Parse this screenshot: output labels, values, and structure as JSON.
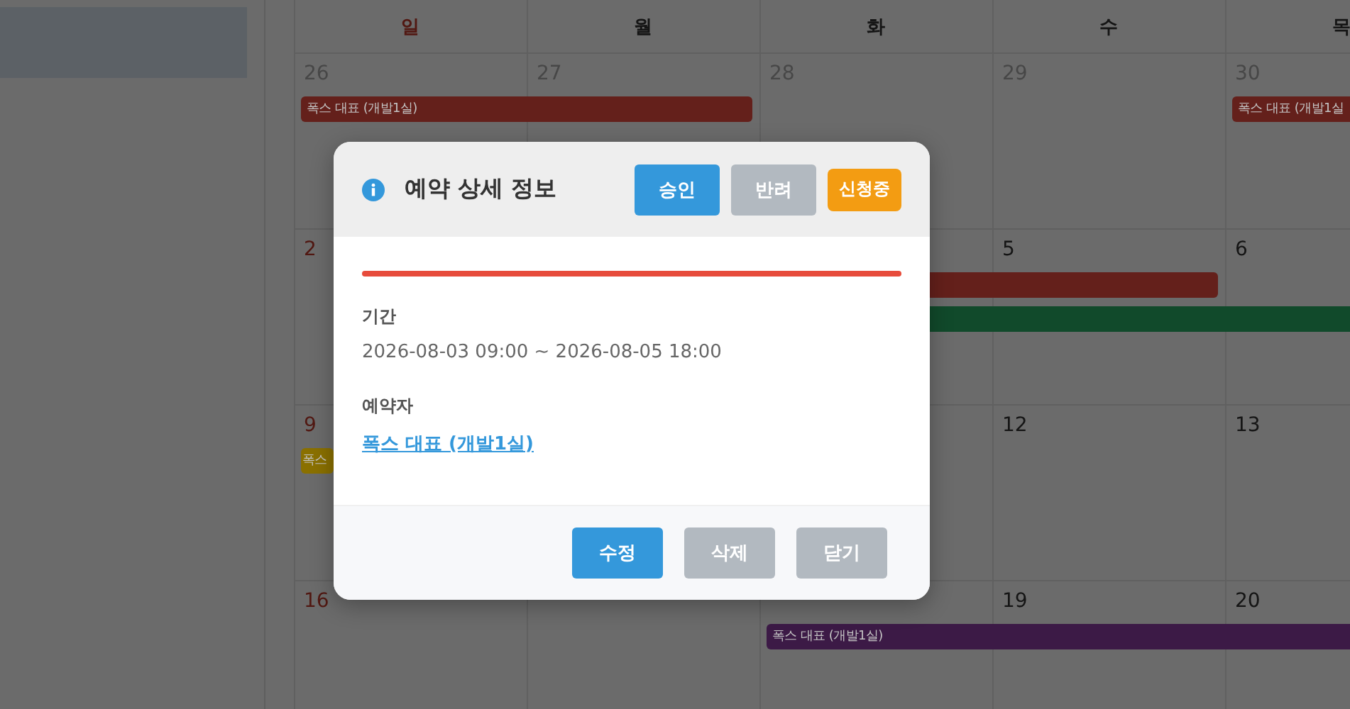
{
  "calendar": {
    "weekdays": [
      {
        "label": "일",
        "kind": "sunday"
      },
      {
        "label": "월",
        "kind": "weekday"
      },
      {
        "label": "화",
        "kind": "weekday"
      },
      {
        "label": "수",
        "kind": "weekday"
      },
      {
        "label": "목",
        "kind": "weekday"
      }
    ],
    "weeks": [
      {
        "days": [
          {
            "kind": "date",
            "label": "26",
            "muted": true,
            "events": [
              {
                "label": "폭스 대표 (개발1실)",
                "color": "#64201b",
                "kind": "two-days"
              }
            ]
          },
          {
            "kind": "date",
            "label": "27",
            "muted": true
          },
          {
            "kind": "date",
            "label": "28",
            "muted": true
          },
          {
            "kind": "date",
            "label": "29",
            "muted": true
          },
          {
            "kind": "date",
            "label": "30",
            "muted": true,
            "events": [
              {
                "label": "폭스 대표 (개발1실",
                "color": "#64201b",
                "kind": "to-edge"
              }
            ]
          }
        ]
      },
      {
        "days": [
          {
            "kind": "date",
            "label": "2",
            "muted": false
          },
          {
            "kind": "covered",
            "events": [
              {
                "color": "#64201b",
                "kind": "three-days"
              },
              {
                "color": "#114a2b",
                "kind": "to-edge"
              }
            ]
          },
          {
            "kind": "covered"
          },
          {
            "kind": "date",
            "label": "5",
            "muted": false
          },
          {
            "kind": "date",
            "label": "6",
            "muted": false
          }
        ]
      },
      {
        "days": [
          {
            "kind": "date",
            "label": "9",
            "muted": false,
            "events": [
              {
                "label": "폭스",
                "color": "#8a7000",
                "kind": "clipped"
              }
            ]
          },
          {
            "kind": "covered"
          },
          {
            "kind": "covered"
          },
          {
            "kind": "date",
            "label": "12",
            "muted": false
          },
          {
            "kind": "date",
            "label": "13",
            "muted": false
          }
        ]
      },
      {
        "days": [
          {
            "kind": "date",
            "label": "16",
            "muted": false
          },
          {
            "kind": "covered"
          },
          {
            "kind": "covered",
            "events": [
              {
                "label": "폭스 대표 (개발1실)",
                "color": "#3c1a46",
                "kind": "to-edge"
              }
            ]
          },
          {
            "kind": "date",
            "label": "19",
            "muted": false
          },
          {
            "kind": "date",
            "label": "20",
            "muted": false
          }
        ]
      }
    ]
  },
  "dialog": {
    "title": "예약 상세 정보",
    "actions": [
      {
        "label": "승인",
        "kind": "primary"
      },
      {
        "label": "반려",
        "kind": "secondary"
      }
    ],
    "status": {
      "label": "신청중",
      "kind": "pending"
    },
    "color": "#e74c3c",
    "fields": [
      {
        "label": "기간",
        "value": "2026-08-03 09:00 ~ 2026-08-05 18:00",
        "kind": "text"
      },
      {
        "label": "예약자",
        "value": "폭스 대표 (개발1실)",
        "kind": "link"
      }
    ],
    "buttons": [
      {
        "label": "수정",
        "kind": "primary"
      },
      {
        "label": "삭제",
        "kind": "secondary"
      },
      {
        "label": "닫기",
        "kind": "secondary"
      }
    ]
  }
}
